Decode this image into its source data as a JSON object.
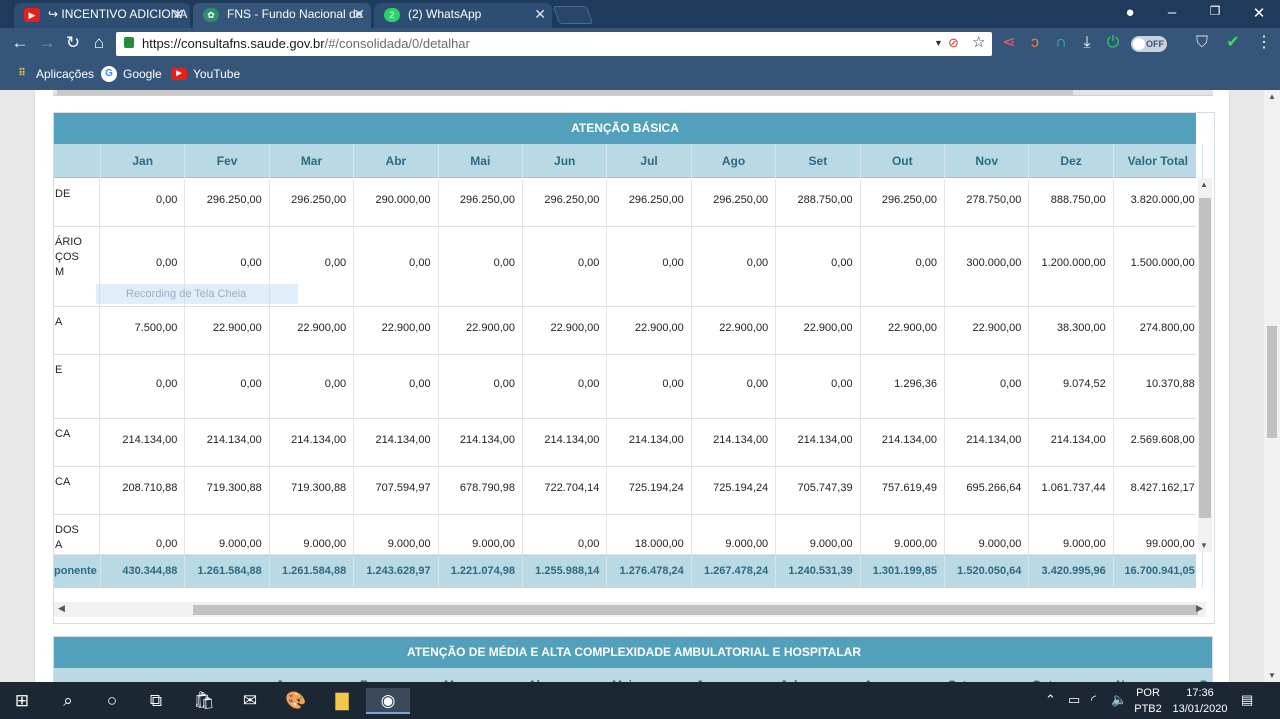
{
  "browser": {
    "tabs": [
      {
        "title": "↪ INCENTIVO ADICIONA",
        "icon": "youtube-icon",
        "active": false
      },
      {
        "title": "FNS - Fundo Nacional de",
        "icon": "fns-icon",
        "active": true
      },
      {
        "title": "(2) WhatsApp",
        "icon": "whatsapp-icon",
        "badge": "2",
        "active": false
      }
    ],
    "tab_close": "✕",
    "url_host": "https://consultafns.saude.gov.br",
    "url_path": "/#/consolidada/0/detalhar",
    "extension_toggle": "OFF",
    "bookmarks": [
      {
        "label": "Aplicações",
        "icon": "apps-grid-icon"
      },
      {
        "label": "Google",
        "icon": "google-icon"
      },
      {
        "label": "YouTube",
        "icon": "youtube-icon"
      }
    ],
    "accent": "#35557a"
  },
  "panel_basic": {
    "title": "ATENÇÃO BÁSICA",
    "columns": [
      "Jan",
      "Fev",
      "Mar",
      "Abr",
      "Mai",
      "Jun",
      "Jul",
      "Ago",
      "Set",
      "Out",
      "Nov",
      "Dez",
      "Valor Total"
    ],
    "rows": [
      {
        "name": "DE",
        "values": [
          "0,00",
          "296.250,00",
          "296.250,00",
          "290.000,00",
          "296.250,00",
          "296.250,00",
          "296.250,00",
          "296.250,00",
          "288.750,00",
          "296.250,00",
          "278.750,00",
          "888.750,00",
          "3.820.000,00"
        ]
      },
      {
        "name": "ÁRIO\nÇOS\nM",
        "values": [
          "0,00",
          "0,00",
          "0,00",
          "0,00",
          "0,00",
          "0,00",
          "0,00",
          "0,00",
          "0,00",
          "0,00",
          "300.000,00",
          "1.200.000,00",
          "1.500.000,00"
        ]
      },
      {
        "name": "A",
        "values": [
          "7.500,00",
          "22.900,00",
          "22.900,00",
          "22.900,00",
          "22.900,00",
          "22.900,00",
          "22.900,00",
          "22.900,00",
          "22.900,00",
          "22.900,00",
          "22.900,00",
          "38.300,00",
          "274.800,00"
        ]
      },
      {
        "name": "E",
        "values": [
          "0,00",
          "0,00",
          "0,00",
          "0,00",
          "0,00",
          "0,00",
          "0,00",
          "0,00",
          "0,00",
          "1.296,36",
          "0,00",
          "9.074,52",
          "10.370,88"
        ]
      },
      {
        "name": "CA",
        "values": [
          "214.134,00",
          "214.134,00",
          "214.134,00",
          "214.134,00",
          "214.134,00",
          "214.134,00",
          "214.134,00",
          "214.134,00",
          "214.134,00",
          "214.134,00",
          "214.134,00",
          "214.134,00",
          "2.569.608,00"
        ]
      },
      {
        "name": "CA",
        "values": [
          "208.710,88",
          "719.300,88",
          "719.300,88",
          "707.594,97",
          "678.790,98",
          "722.704,14",
          "725.194,24",
          "725.194,24",
          "705.747,39",
          "757.619,49",
          "695.266,64",
          "1.061.737,44",
          "8.427.162,17"
        ]
      },
      {
        "name": "DOS\nA",
        "values": [
          "0,00",
          "9.000,00",
          "9.000,00",
          "9.000,00",
          "9.000,00",
          "0,00",
          "18.000,00",
          "9.000,00",
          "9.000,00",
          "9.000,00",
          "9.000,00",
          "9.000,00",
          "99.000,00"
        ]
      }
    ],
    "total": {
      "label": "ponente",
      "values": [
        "430.344,88",
        "1.261.584,88",
        "1.261.584,88",
        "1.243.628,97",
        "1.221.074,98",
        "1.255.988,14",
        "1.276.478,24",
        "1.267.478,24",
        "1.240.531,39",
        "1.301.199,85",
        "1.520.050,64",
        "3.420.995,96",
        "16.700.941,05"
      ]
    },
    "ghost_overlay": "Recording de Tela Cheia",
    "header_color": "#52a0bb",
    "subheader_color": "#b9d9e5"
  },
  "panel_mac": {
    "title": "ATENÇÃO DE MÉDIA E ALTA COMPLEXIDADE AMBULATORIAL E HOSPITALAR",
    "partial_columns": [
      "Jan",
      "Fev",
      "Mar",
      "Abr",
      "Mai",
      "Jun",
      "Jul",
      "Ago",
      "Set",
      "Out",
      "Nov",
      "D"
    ]
  },
  "taskbar": {
    "language": "POR",
    "layout": "PTB2",
    "time": "17:36",
    "date": "13/01/2020"
  }
}
